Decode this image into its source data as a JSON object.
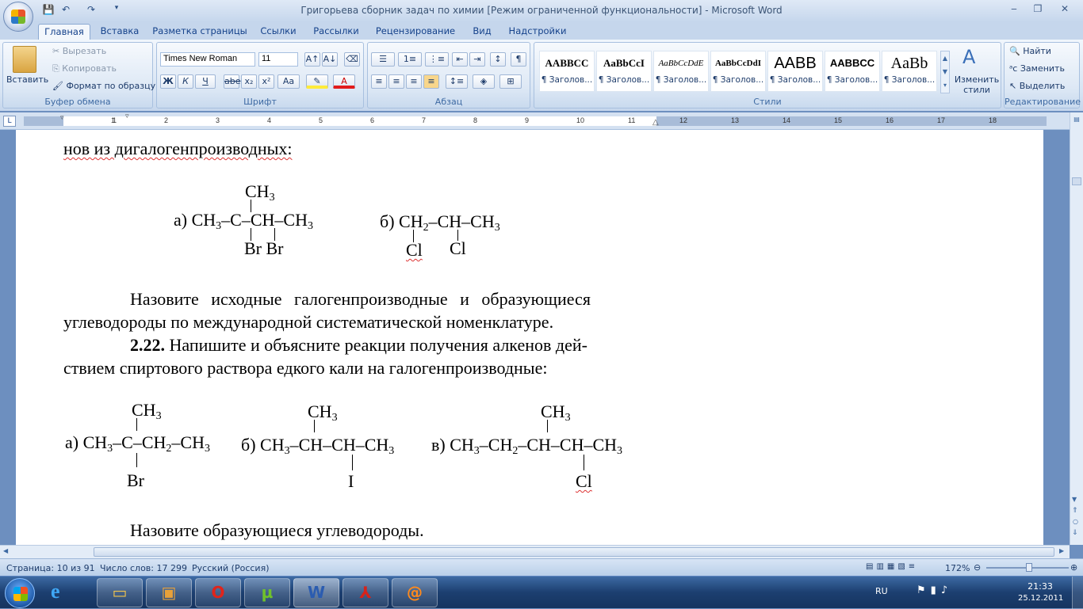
{
  "window": {
    "title": "Григорьева сборник задач по химии [Режим ограниченной функциональности] - Microsoft Word",
    "controls": [
      "‒",
      "❐",
      "✕"
    ]
  },
  "tabs": [
    "Главная",
    "Вставка",
    "Разметка страницы",
    "Ссылки",
    "Рассылки",
    "Рецензирование",
    "Вид",
    "Надстройки"
  ],
  "ribbon": {
    "clipboard": {
      "label": "Буфер обмена",
      "paste": "Вставить",
      "cut": "Вырезать",
      "copy": "Копировать",
      "format_painter": "Формат по образцу"
    },
    "font": {
      "label": "Шрифт",
      "font_name": "Times New Roman",
      "font_size": "11",
      "bold": "Ж",
      "italic": "К",
      "underline": "Ч",
      "strike": "abe",
      "sub": "x₂",
      "sup": "x²",
      "case": "Aa"
    },
    "paragraph": {
      "label": "Абзац"
    },
    "styles": {
      "label": "Стили",
      "items": [
        {
          "sample": "AABBCC",
          "name": "¶ Заголов..."
        },
        {
          "sample": "AaBbCcI",
          "name": "¶ Заголов..."
        },
        {
          "sample": "AaBbCcDdE",
          "name": "¶ Заголов..."
        },
        {
          "sample": "AaBbCcDdI",
          "name": "¶ Заголов..."
        },
        {
          "sample": "AABB",
          "name": "¶ Заголов..."
        },
        {
          "sample": "AABBCC",
          "name": "¶ Заголов..."
        },
        {
          "sample": "AaBb",
          "name": "¶ Заголов..."
        }
      ],
      "change_styles": "Изменить стили"
    },
    "editing": {
      "label": "Редактирование",
      "find": "Найти",
      "replace": "Заменить",
      "select": "Выделить"
    }
  },
  "ruler": {
    "numbers": [
      "1",
      "1",
      "2",
      "3",
      "4",
      "5",
      "6",
      "7",
      "8",
      "9",
      "10",
      "11",
      "12",
      "13",
      "14",
      "15",
      "16",
      "17",
      "18"
    ]
  },
  "document": {
    "top_line": "нов из дигалогенпроизводных:",
    "p1_line1": "Назовите исходные галогенпроизводные и образующиеся",
    "p1_line2": "углеводороды по международной систематической номенклатуре.",
    "p2_num": "2.22.",
    "p2_line1": " Напишите и объясните реакции получения алкенов дей-",
    "p2_line2": "ствием спиртового раствора едкого кали на галогенпроизводные:",
    "p3": "Назовите образующиеся углеводороды.",
    "formula_a1": {
      "label": "а)",
      "top": "CH",
      "main_1": "CH",
      "main_2": "–C–CH–CH",
      "subs": "3",
      "bottom": "Br Br"
    },
    "formula_b1": {
      "label": "б)",
      "main": "CH",
      "main_2": "–CH–CH",
      "sub2": "2",
      "sub3": "3",
      "bottom_1": "Cl",
      "bottom_2": "Cl"
    },
    "formula_a2": {
      "label": "а)",
      "top": "CH",
      "main_1": "CH",
      "main_2": "–C–CH",
      "main_3": "–CH",
      "bottom": "Br"
    },
    "formula_b2": {
      "label": "б)",
      "top": "CH",
      "main_1": "CH",
      "main_2": "–CH–CH–CH",
      "bottom": "I"
    },
    "formula_v2": {
      "label": "в)",
      "top": "CH",
      "main_1": "CH",
      "main_2": "–CH",
      "main_3": "–CH–CH–CH",
      "bottom": "Cl"
    },
    "num3": "3",
    "num2": "2"
  },
  "status": {
    "page": "Страница: 10 из 91",
    "words": "Число слов: 17 299",
    "language": "Русский (Россия)",
    "zoom": "172%"
  },
  "taskbar": {
    "lang": "RU",
    "time": "21:33",
    "date": "25.12.2011"
  }
}
